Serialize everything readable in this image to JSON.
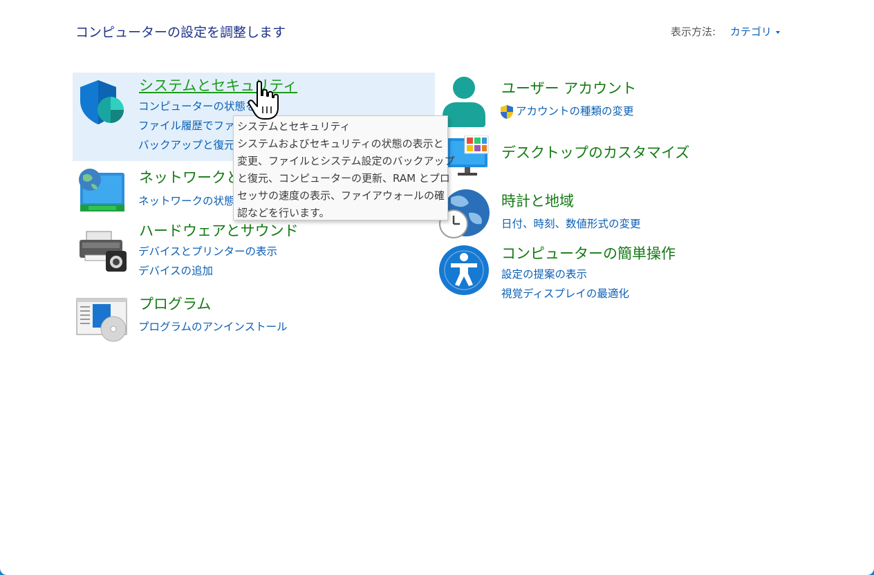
{
  "page_title": "コンピューターの設定を調整します",
  "view_by": {
    "label": "表示方法:",
    "value": "カテゴリ"
  },
  "left_categories": [
    {
      "title": "システムとセキュリティ",
      "icon": "security-shield-icon",
      "links": [
        "コンピューターの状態を確",
        "ファイル履歴でファイ",
        "バックアップと復元"
      ]
    },
    {
      "title": "ネットワークとイ",
      "icon": "network-globe-icon",
      "links": [
        "ネットワークの状態と"
      ]
    },
    {
      "title": "ハードウェアとサウンド",
      "icon": "printer-camera-icon",
      "links": [
        "デバイスとプリンターの表示",
        "デバイスの追加"
      ]
    },
    {
      "title": "プログラム",
      "icon": "programs-disc-icon",
      "links": [
        "プログラムのアンインストール"
      ]
    }
  ],
  "right_categories": [
    {
      "title": "ユーザー アカウント",
      "icon": "user-person-icon",
      "links": [
        "アカウントの種類の変更"
      ]
    },
    {
      "title": "デスクトップのカスタマイズ",
      "icon": "monitor-icon",
      "links": []
    },
    {
      "title": "時計と地域",
      "icon": "clock-globe-icon",
      "links": [
        "日付、時刻、数値形式の変更"
      ]
    },
    {
      "title": "コンピューターの簡単操作",
      "icon": "accessibility-icon",
      "links": [
        "設定の提案の表示",
        "視覚ディスプレイの最適化"
      ]
    }
  ],
  "tooltip": {
    "title": "システムとセキュリティ",
    "lines": [
      "システムおよびセキュリティの状態の表示と",
      "変更、ファイルとシステム設定のバックアップ",
      "と復元、コンピューターの更新、RAM とプロ",
      "セッサの速度の表示、ファイアウォールの確",
      "認などを行います。"
    ]
  },
  "colors": {
    "title": "#137a13",
    "link": "#0b5fb5",
    "heading": "#1e3287",
    "hover": "#e3f0fb"
  }
}
